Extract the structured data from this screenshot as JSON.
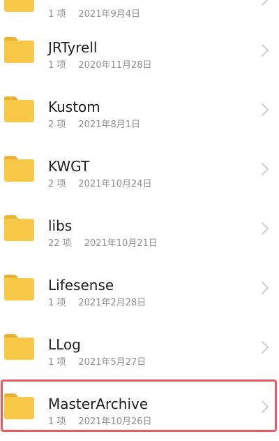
{
  "folders": [
    {
      "name": "",
      "count": "1 项",
      "date": "2021年9月4日"
    },
    {
      "name": "JRTyrell",
      "count": "1 项",
      "date": "2020年11月28日"
    },
    {
      "name": "Kustom",
      "count": "2 项",
      "date": "2021年8月1日"
    },
    {
      "name": "KWGT",
      "count": "2 项",
      "date": "2021年10月24日"
    },
    {
      "name": "libs",
      "count": "22 项",
      "date": "2021年10月21日"
    },
    {
      "name": "Lifesense",
      "count": "1 项",
      "date": "2021年2月28日"
    },
    {
      "name": "LLog",
      "count": "1 项",
      "date": "2021年5月27日"
    },
    {
      "name": "MasterArchive",
      "count": "1 项",
      "date": "2021年10月26日"
    }
  ],
  "highlighted_folder": "MasterArchive",
  "colors": {
    "folder": "#f6c845",
    "folder_tab": "#eab232",
    "highlight_border": "#e75a5f"
  },
  "icons": {
    "folder": "folder-icon",
    "chevron": "chevron-right-icon"
  }
}
